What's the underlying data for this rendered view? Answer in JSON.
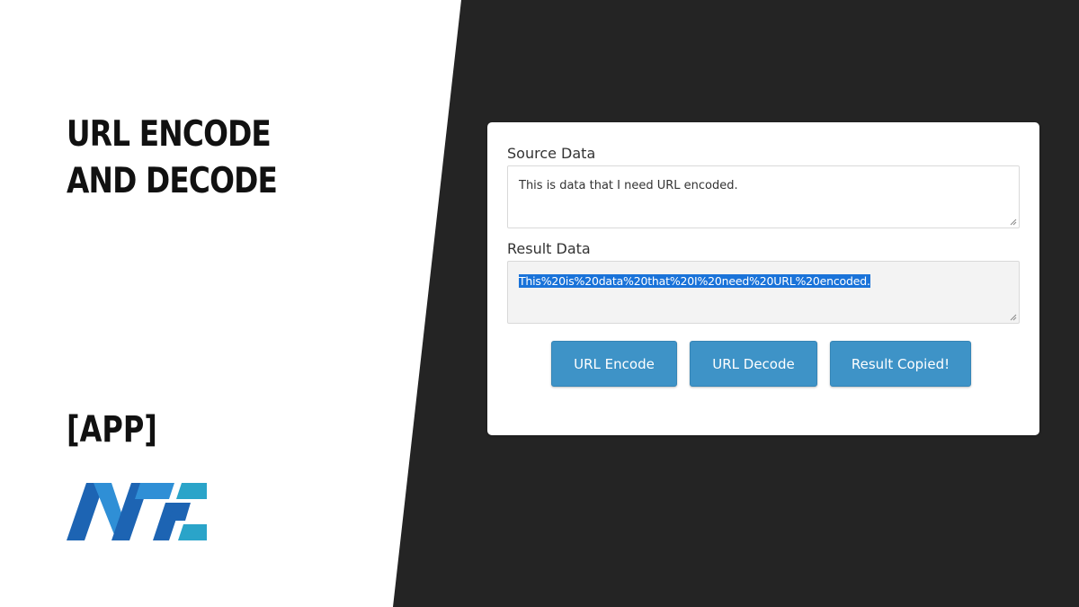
{
  "hero": {
    "title": "URL ENCODE AND DECODE",
    "tag": "[APP]"
  },
  "logo": {
    "icon": "mtc-logo",
    "colors": [
      "#1d64b3",
      "#2f8fd6",
      "#2aa4c9"
    ]
  },
  "form": {
    "source_label": "Source Data",
    "source_value": "This is data that I need URL encoded.",
    "result_label": "Result Data",
    "result_value": "This%20is%20data%20that%20I%20need%20URL%20encoded."
  },
  "buttons": {
    "encode": "URL Encode",
    "decode": "URL Decode",
    "copy": "Result Copied!"
  },
  "colors": {
    "dark_background": "#242424",
    "button": "#3e93c7",
    "selection": "#1a73d9"
  }
}
